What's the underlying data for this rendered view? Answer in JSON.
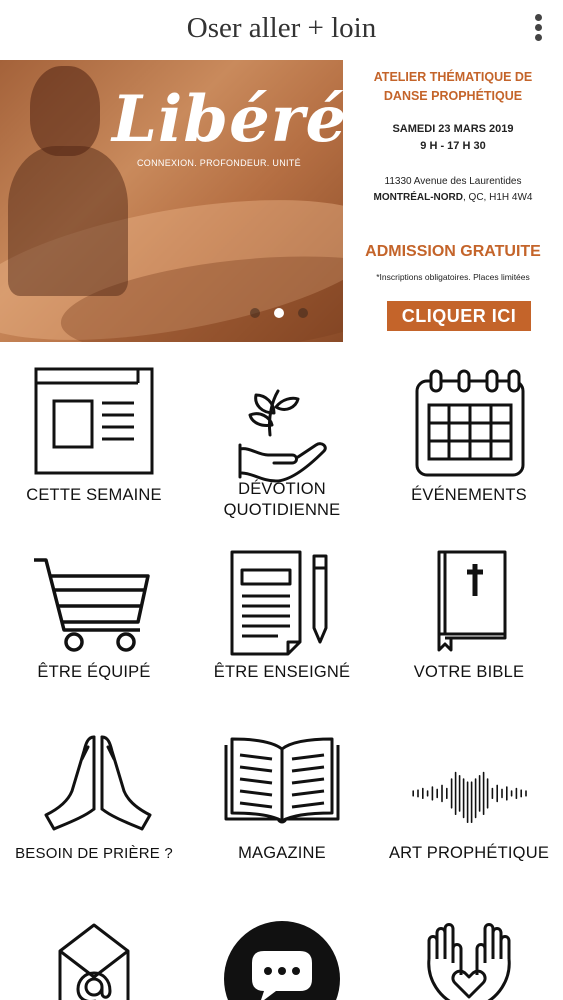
{
  "app": {
    "title": "Oser aller + loin",
    "menu_icon": "more-vert-icon"
  },
  "banner": {
    "headline": "Libéré",
    "tagline": "CONNEXION. PROFONDEUR. UNITÉ",
    "event_title": "ATELIER THÉMATIQUE DE DANSE PROPHÉTIQUE",
    "date": "SAMEDI 23 MARS 2019",
    "hours": "9 H - 17 H 30",
    "address_line1": "11330 Avenue des Laurentides",
    "address_city": "MONTRÉAL-NORD",
    "address_rest": ", QC, H1H 4W4",
    "admission": "ADMISSION GRATUITE",
    "note": "*Inscriptions obligatoires. Places limitées",
    "cta": "CLIQUER ICI",
    "slide_count": 3,
    "active_slide": 2,
    "accent_color": "#c4642a"
  },
  "tiles": [
    {
      "label": "CETTE SEMAINE",
      "icon": "newspaper-icon"
    },
    {
      "label": "DÉVOTION QUOTIDIENNE",
      "icon": "hand-leaf-icon"
    },
    {
      "label": "ÉVÉNEMENTS",
      "icon": "calendar-icon"
    },
    {
      "label": "ÊTRE ÉQUIPÉ",
      "icon": "shopping-cart-icon"
    },
    {
      "label": "ÊTRE ENSEIGNÉ",
      "icon": "document-pencil-icon"
    },
    {
      "label": "VOTRE BIBLE",
      "icon": "bible-icon"
    },
    {
      "label": "BESOIN DE PRIÈRE ?",
      "icon": "praying-hands-icon"
    },
    {
      "label": "MAGAZINE",
      "icon": "open-book-icon"
    },
    {
      "label": "ART PROPHÉTIQUE",
      "icon": "sound-wave-icon"
    },
    {
      "label": "",
      "icon": "mail-at-icon"
    },
    {
      "label": "",
      "icon": "chat-bubble-icon"
    },
    {
      "label": "",
      "icon": "hands-heart-icon"
    }
  ]
}
